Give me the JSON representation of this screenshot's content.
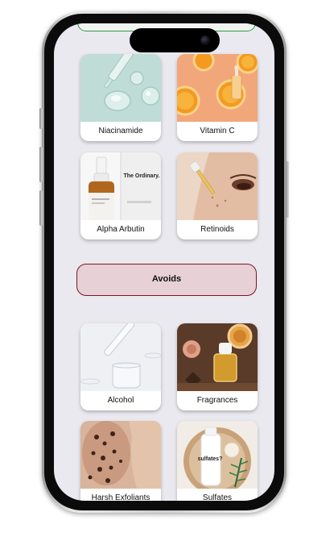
{
  "recommended_items": [
    {
      "label": "Niacinamide"
    },
    {
      "label": "Vitamin C"
    },
    {
      "label": "Alpha Arbutin"
    },
    {
      "label": "Retinoids"
    }
  ],
  "avoids_button": {
    "label": "Avoids"
  },
  "avoid_items": [
    {
      "label": "Alcohol"
    },
    {
      "label": "Fragrances"
    },
    {
      "label": "Harsh Exfoliants"
    },
    {
      "label": "Sulfates"
    }
  ],
  "product_images": {
    "alpha_arbutin_brand": "The Ordinary.",
    "sulfates_bottle_text": "sulfates?"
  },
  "colors": {
    "screen_background": "#eae9ef",
    "avoids_border": "#7a1624",
    "avoids_fill": "#e7d0d6",
    "top_button_border": "#2e9a45"
  }
}
